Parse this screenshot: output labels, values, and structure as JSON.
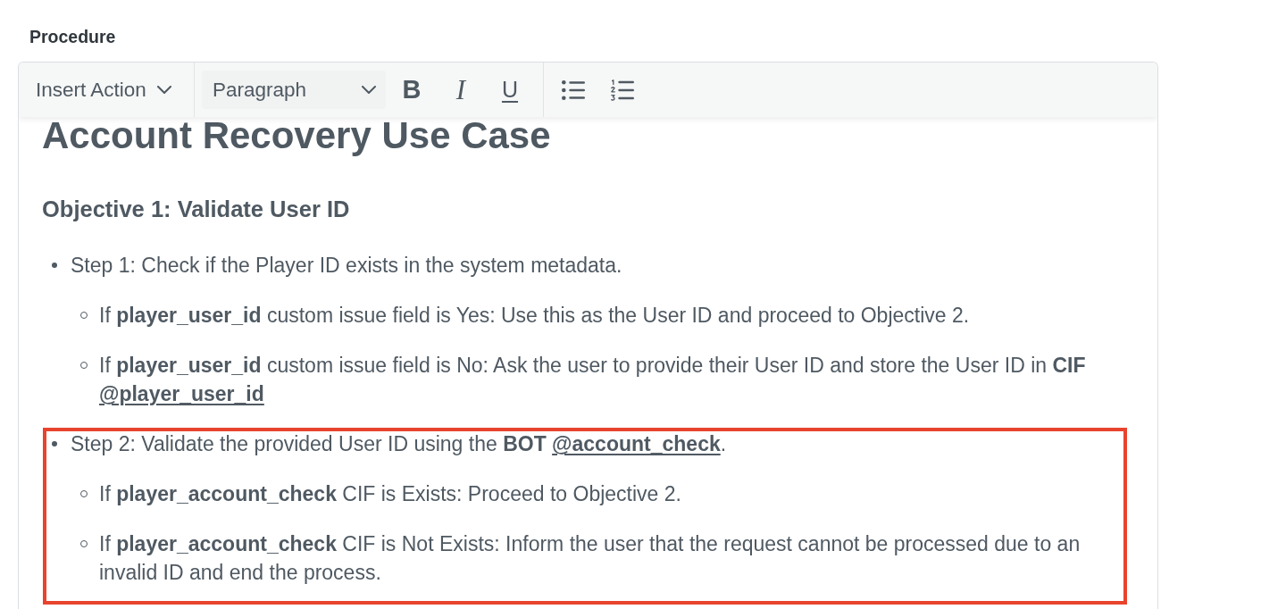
{
  "section_label": "Procedure",
  "editor": {
    "toolbar": {
      "insert_menu": {
        "label": "Insert Action"
      },
      "block_format": {
        "value": "Paragraph"
      },
      "format_buttons": [
        {
          "kind": "bold",
          "label": "B"
        },
        {
          "kind": "italic",
          "label": "I"
        },
        {
          "kind": "underline",
          "label": "U"
        }
      ],
      "list_buttons": [
        {
          "kind": "bulleted"
        },
        {
          "kind": "numbered"
        }
      ]
    },
    "document": {
      "title": "Account Recovery Use Case",
      "heading": "Objective 1: Validate User ID",
      "steps": [
        {
          "highlighted": false,
          "parts": [
            {
              "kind": "text",
              "text": "Step 1: Check if the Player ID exists in the system metadata."
            }
          ],
          "children": [
            {
              "parts": [
                {
                  "kind": "text",
                  "text": "If **player_user_id** custom issue field is Yes: Use this as the User ID and proceed to Objective 2."
                }
              ]
            },
            {
              "parts": [
                {
                  "kind": "text",
                  "text": "If **player_user_id** custom issue field is No: Ask the user to provide their User ID and store the User ID in **CIF** "
                },
                {
                  "kind": "link",
                  "text": "@player_user_id"
                }
              ]
            }
          ]
        },
        {
          "highlighted": true,
          "parts": [
            {
              "kind": "text",
              "text": "Step 2: Validate the provided User ID using the **BOT** "
            },
            {
              "kind": "link",
              "text": "@account_check"
            },
            {
              "kind": "text",
              "text": "."
            }
          ],
          "children": [
            {
              "parts": [
                {
                  "kind": "text",
                  "text": "If **player_account_check** CIF is Exists: Proceed to Objective 2."
                }
              ]
            },
            {
              "parts": [
                {
                  "kind": "text",
                  "text": "If **player_account_check** CIF is Not Exists: Inform the user that the request cannot be processed due to an invalid ID and end the process."
                }
              ]
            }
          ]
        }
      ]
    }
  }
}
